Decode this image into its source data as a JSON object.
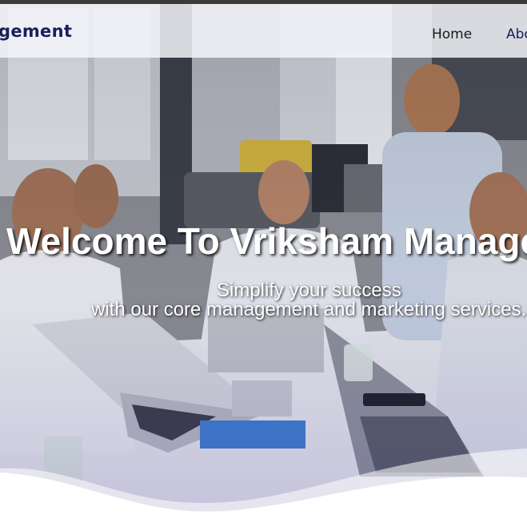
{
  "nav": {
    "brand": "gement",
    "links": [
      {
        "label": "Home"
      },
      {
        "label": "Abo"
      }
    ]
  },
  "hero": {
    "headline": "Welcome To Vriksham Manage",
    "tagline_line1": "Simplify your success",
    "tagline_line2": "with our core management and marketing services."
  },
  "colors": {
    "brand": "#1a1f5c",
    "navbar_bg": "#f0f1f6",
    "hero_text": "#ffffff",
    "wave": "#ffffff"
  }
}
